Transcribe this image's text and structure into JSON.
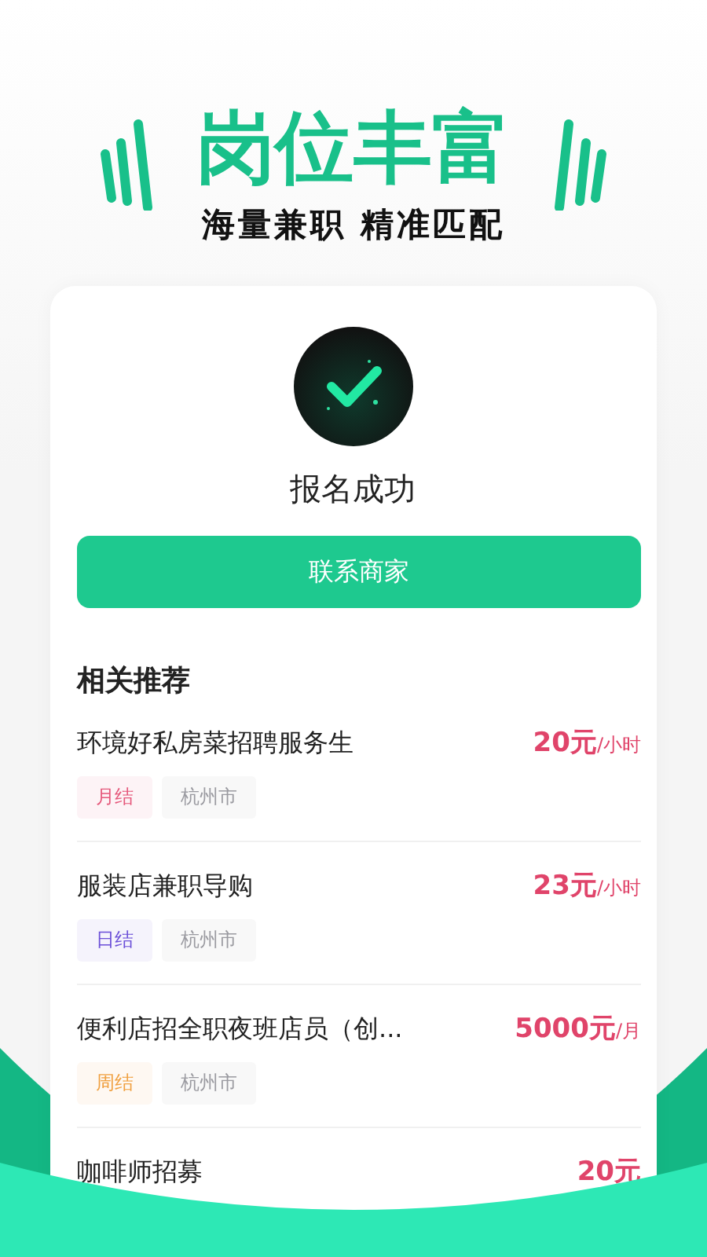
{
  "banner": {
    "title": "岗位丰富",
    "subtitle": "海量兼职 精准匹配"
  },
  "status": {
    "message": "报名成功",
    "button": "联系商家"
  },
  "recommend": {
    "heading": "相关推荐",
    "items": [
      {
        "title": "环境好私房菜招聘服务生",
        "price": "20元",
        "unit": "/小时",
        "tags": [
          {
            "label": "月结",
            "color": "#e5577a"
          },
          {
            "label": "杭州市",
            "color": "#9a9aa0"
          }
        ]
      },
      {
        "title": "服装店兼职导购",
        "price": "23元",
        "unit": "/小时",
        "tags": [
          {
            "label": "日结",
            "color": "#6b4fd8"
          },
          {
            "label": "杭州市",
            "color": "#9a9aa0"
          }
        ]
      },
      {
        "title": "便利店招全职夜班店员（创...",
        "price": "5000元",
        "unit": "/月",
        "tags": [
          {
            "label": "周结",
            "color": "#f0a040"
          },
          {
            "label": "杭州市",
            "color": "#9a9aa0"
          }
        ]
      },
      {
        "title": "咖啡师招募",
        "price": "20元"
      }
    ]
  }
}
